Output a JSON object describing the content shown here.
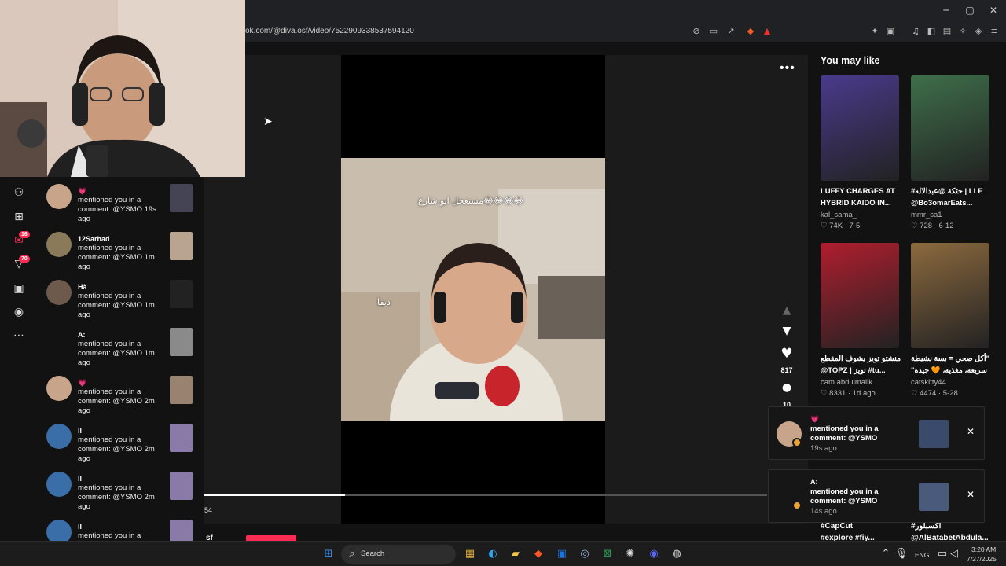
{
  "browser": {
    "url": "ok.com/@diva.osf/video/7522909338537594120",
    "controls": {
      "minimize": "─",
      "maximize": "▢",
      "close": "✕"
    }
  },
  "rail": {
    "badges": [
      "16",
      "70"
    ]
  },
  "notifications": [
    {
      "name": "💗",
      "text": "mentioned you in a comment: @YSMO 19s ago",
      "avatar_color": "#c8a58a",
      "thumb_color": "#445"
    },
    {
      "name": "12Sarhad",
      "text": "mentioned you in a comment: @YSMO 1m ago",
      "avatar_color": "#8a7a5a",
      "thumb_color": "#b9a48f"
    },
    {
      "name": "Hà",
      "text": "mentioned you in a comment: @YSMO 1m ago",
      "avatar_color": "#6e5a4c",
      "thumb_color": "#222"
    },
    {
      "name": "A:",
      "text": "mentioned you in a comment: @YSMO 1m ago",
      "avatar_color": "#121212",
      "thumb_color": "#8a8a8a"
    },
    {
      "name": "💗",
      "text": "mentioned you in a comment: @YSMO 2m ago",
      "avatar_color": "#c8a58a",
      "thumb_color": "#9a8270"
    },
    {
      "name": "ll",
      "text": "mentioned you in a comment: @YSMO 2m ago",
      "avatar_color": "#3a6ea8",
      "thumb_color": "#8a7aa8"
    },
    {
      "name": "ll",
      "text": "mentioned you in a comment: @YSMO 2m ago",
      "avatar_color": "#3a6ea8",
      "thumb_color": "#8a7aa8"
    },
    {
      "name": "ll",
      "text": "mentioned you in a comment: @YSMO",
      "avatar_color": "#3a6ea8",
      "thumb_color": "#8a7aa8"
    }
  ],
  "video": {
    "caption_top": "مستعجل ابو شارع😂😂😂😂",
    "caption_mid": "ديفا",
    "likes": "817",
    "comments": "10",
    "time": "54",
    "progress": 0.25,
    "handle": "sf",
    "more": "•••"
  },
  "you_may_like": {
    "title": "You may like",
    "cards": [
      {
        "title1": "LUFFY CHARGES AT",
        "title2": "HYBRID KAIDO IN...",
        "author": "kal_sama_",
        "likes": "74K",
        "date": "7-5",
        "thumb_color": "#4a3a8c"
      },
      {
        "title1": "#حتكة @عبدالاله | LLE",
        "title2": "@Bo3omarEats...",
        "author": "mmr_sa1",
        "likes": "728",
        "date": "6-12",
        "thumb_color": "#3e6f4a"
      },
      {
        "title1": "منشتو تويز يشوف المقطع",
        "title2": "@TOPZ | تويز #tu...",
        "author": "cam.abdulmalik",
        "likes": "8331",
        "date": "1d ago",
        "thumb_color": "#b01e2e"
      },
      {
        "title1": "أكل صحي = بسة نشيطة\"",
        "title2": "\"سريعة، مغذية، 🧡 جيدة",
        "author": "catskitty44",
        "likes": "4474",
        "date": "5-28",
        "thumb_color": "#8c6a3e"
      }
    ],
    "tags_left": [
      "#CapCut",
      "#explore #fiy..."
    ],
    "tags_right": [
      "#اكسبلور",
      "@AlBatabetAbdula..."
    ]
  },
  "toasts": [
    {
      "name": "💗",
      "text": "mentioned you in a comment: @YSMO",
      "time": "19s ago",
      "avatar_color": "#c8a58a",
      "thumb_color": "#3a4a6a"
    },
    {
      "name": "A:",
      "text": "mentioned you in a comment: @YSMO",
      "time": "14s ago",
      "avatar_color": "#161616",
      "thumb_color": "#4a5a7a"
    }
  ],
  "taskbar": {
    "search_label": "Search",
    "lang": "ENG",
    "time": "3:20 AM",
    "date": "7/27/2025"
  },
  "colors": {
    "accent": "#fe2c55",
    "background": "#121212"
  }
}
